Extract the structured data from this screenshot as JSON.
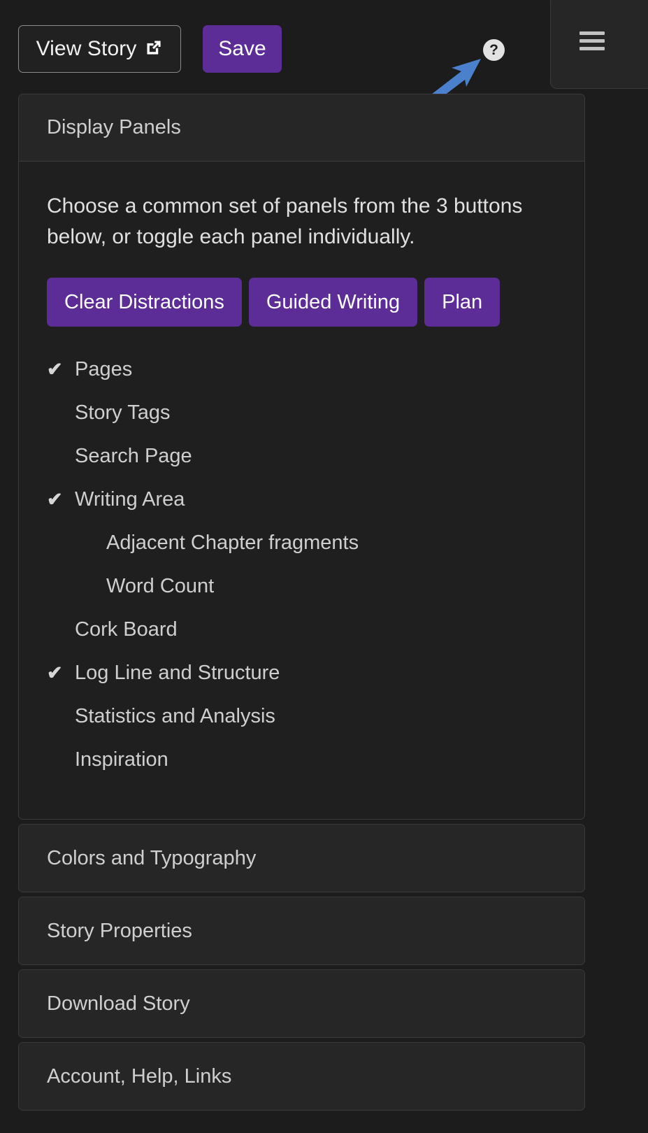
{
  "toolbar": {
    "view_story_label": "View Story",
    "view_story_icon": "external-link-icon",
    "save_label": "Save",
    "help_label": "?",
    "help_icon": "question-mark-circle-icon",
    "menu_icon": "hamburger-menu-icon",
    "annotation_icon": "blue-arrow-annotation"
  },
  "colors": {
    "accent_purple": "#5c2d96",
    "panel_bg": "#262626",
    "body_bg": "#1f1f1f",
    "page_bg": "#1c1c1c",
    "border": "#3b3b3b",
    "text": "#cfcfcf",
    "annotation_blue": "#4b80cd"
  },
  "sections": [
    {
      "title": "Display Panels",
      "open": true,
      "description": "Choose a common set of panels from the 3 buttons below, or toggle each panel individually.",
      "presets": [
        {
          "label": "Clear Distractions"
        },
        {
          "label": "Guided Writing"
        },
        {
          "label": "Plan"
        }
      ],
      "panels": [
        {
          "label": "Pages",
          "checked": true,
          "level": 1
        },
        {
          "label": "Story Tags",
          "checked": false,
          "level": 1
        },
        {
          "label": "Search Page",
          "checked": false,
          "level": 1
        },
        {
          "label": "Writing Area",
          "checked": true,
          "level": 1
        },
        {
          "label": "Adjacent Chapter fragments",
          "checked": false,
          "level": 2
        },
        {
          "label": "Word Count",
          "checked": false,
          "level": 2
        },
        {
          "label": "Cork Board",
          "checked": false,
          "level": 1
        },
        {
          "label": "Log Line and Structure",
          "checked": true,
          "level": 1
        },
        {
          "label": "Statistics and Analysis",
          "checked": false,
          "level": 1
        },
        {
          "label": "Inspiration",
          "checked": false,
          "level": 1
        }
      ]
    },
    {
      "title": "Colors and Typography",
      "open": false
    },
    {
      "title": "Story Properties",
      "open": false
    },
    {
      "title": "Download Story",
      "open": false
    },
    {
      "title": "Account, Help, Links",
      "open": false
    }
  ],
  "checkmark_glyph": "✔"
}
